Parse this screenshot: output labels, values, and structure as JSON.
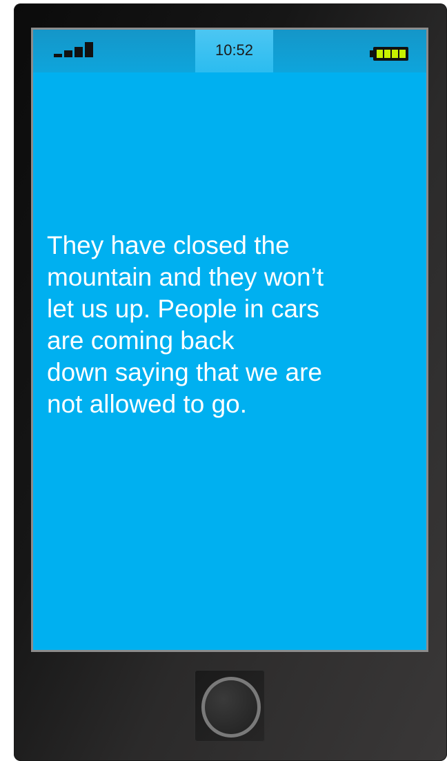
{
  "status_bar": {
    "time": "10:52",
    "signal_bars": 4,
    "battery_level": 1.0
  },
  "message": {
    "text": "They have closed the\nmountain and they won’t\nlet us up. People in cars\nare coming back\ndown saying that we are\nnot allowed to go."
  },
  "colors": {
    "screen_background": "#00b0f0",
    "status_bar": "#1596c8",
    "status_bar_center": "#4cc6f2",
    "message_text": "#ffffff",
    "battery_fill": "#c8f000",
    "phone_body": "#1a1a1a"
  },
  "icons": {
    "signal": "signal-strength-icon",
    "battery": "battery-icon",
    "home": "home-button-icon"
  }
}
